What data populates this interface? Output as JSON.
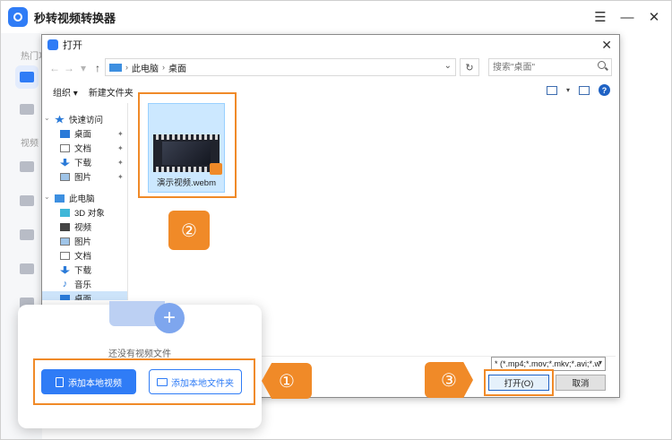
{
  "app": {
    "title": "秒转视频转换器",
    "sidebar_sections": [
      "热门功",
      "视频"
    ]
  },
  "dialog": {
    "title": "打开",
    "breadcrumb": [
      "此电脑",
      "桌面"
    ],
    "search_placeholder": "搜索\"桌面\"",
    "toolbar": {
      "organize": "组织 ▾",
      "new_folder": "新建文件夹"
    },
    "tree": {
      "quick_access": "快速访问",
      "quick_items": [
        "桌面",
        "文档",
        "下载",
        "图片"
      ],
      "this_pc": "此电脑",
      "pc_items": [
        "3D 对象",
        "视频",
        "图片",
        "文档",
        "下载",
        "音乐",
        "桌面"
      ]
    },
    "file": {
      "name": "演示视频.webm"
    },
    "filter": "* (*.mp4;*.mov;*.mkv;*.avi;*.w",
    "open_button": "打开(O)",
    "cancel_button": "取消"
  },
  "card": {
    "empty_text": "还没有视频文件",
    "add_video": "添加本地视频",
    "add_folder": "添加本地文件夹"
  },
  "steps": [
    "①",
    "②",
    "③"
  ],
  "colors": {
    "accent": "#2f7cf6",
    "highlight": "#f08a28"
  }
}
